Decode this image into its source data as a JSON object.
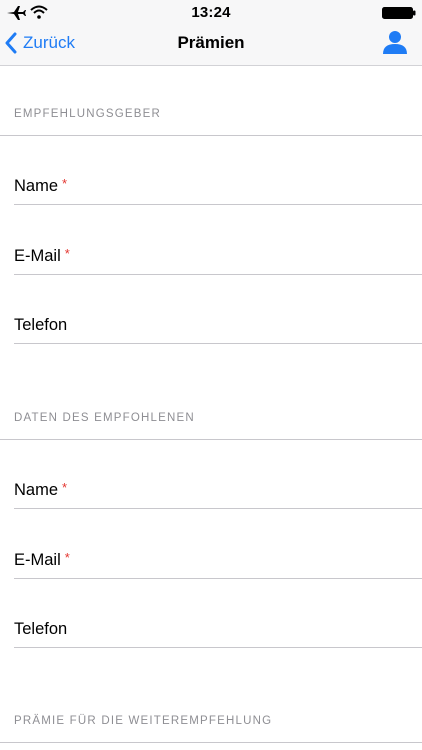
{
  "status_bar": {
    "time": "13:24",
    "icons": [
      "airplane-icon",
      "wifi-icon",
      "battery-icon"
    ]
  },
  "nav": {
    "back_label": "Zurück",
    "title": "Prämien",
    "right_icon": "person-icon"
  },
  "required_marker": "*",
  "sections": [
    {
      "header": "EMPFEHLUNGSGEBER",
      "fields": [
        {
          "label": "Name",
          "required": true
        },
        {
          "label": "E-Mail",
          "required": true
        },
        {
          "label": "Telefon",
          "required": false
        }
      ]
    },
    {
      "header": "DATEN DES EMPFOHLENEN",
      "fields": [
        {
          "label": "Name",
          "required": true
        },
        {
          "label": "E-Mail",
          "required": true
        },
        {
          "label": "Telefon",
          "required": false
        }
      ]
    },
    {
      "header": "PRÄMIE FÜR DIE WEITEREMPFEHLUNG",
      "fields": []
    }
  ],
  "colors": {
    "accent": "#1f7cf5",
    "required": "#e3342f",
    "section_header": "#8e8e93",
    "separator": "#c8c7cc"
  }
}
